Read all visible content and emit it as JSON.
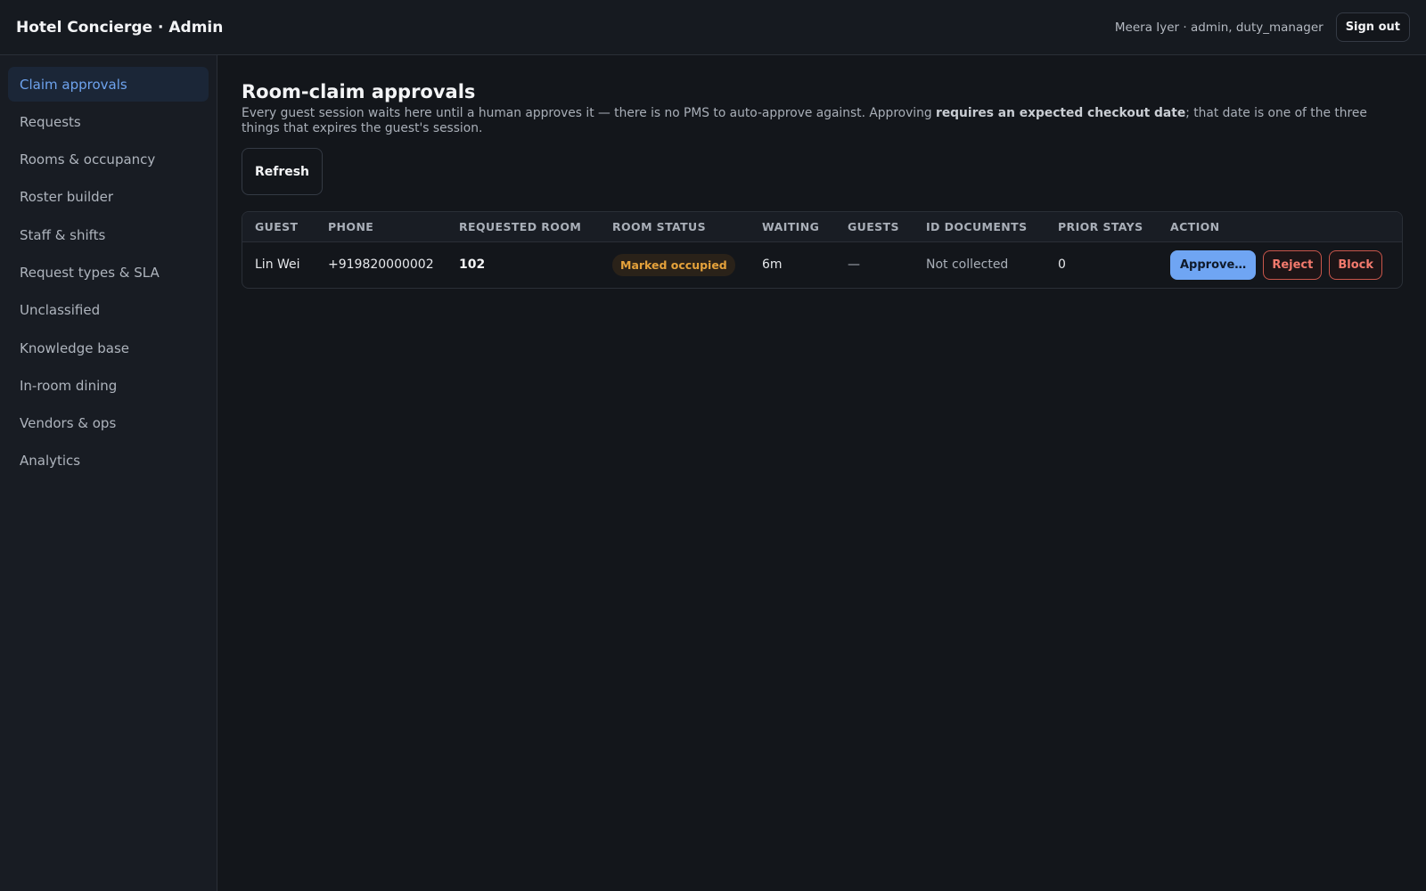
{
  "header": {
    "title": "Hotel Concierge · Admin",
    "user": "Meera Iyer · admin, duty_manager",
    "sign_out_label": "Sign out"
  },
  "sidebar": {
    "items": [
      {
        "label": "Claim approvals",
        "active": true
      },
      {
        "label": "Requests"
      },
      {
        "label": "Rooms & occupancy"
      },
      {
        "label": "Roster builder"
      },
      {
        "label": "Staff & shifts"
      },
      {
        "label": "Request types & SLA"
      },
      {
        "label": "Unclassified"
      },
      {
        "label": "Knowledge base"
      },
      {
        "label": "In-room dining"
      },
      {
        "label": "Vendors & ops"
      },
      {
        "label": "Analytics"
      }
    ]
  },
  "main": {
    "title": "Room-claim approvals",
    "description_pre": "Every guest session waits here until a human approves it — there is no PMS to auto-approve against. Approving ",
    "description_bold": "requires an expected checkout date",
    "description_post": "; that date is one of the three things that expires the guest's session.",
    "refresh_label": "Refresh",
    "table": {
      "columns": [
        "GUEST",
        "PHONE",
        "REQUESTED ROOM",
        "ROOM STATUS",
        "WAITING",
        "GUESTS",
        "ID DOCUMENTS",
        "PRIOR STAYS",
        "ACTION"
      ],
      "rows": [
        {
          "guest": "Lin Wei",
          "phone": "+919820000002",
          "room": "102",
          "status": "Marked occupied",
          "waiting": "6m",
          "guests": "—",
          "id_documents": "Not collected",
          "prior_stays": "0",
          "approve_label": "Approve…",
          "reject_label": "Reject",
          "block_label": "Block"
        }
      ]
    }
  },
  "colors": {
    "accent": "#6fa5f3",
    "warning": "#e5a23b",
    "danger": "#f37a6d",
    "background": "#13161b"
  }
}
